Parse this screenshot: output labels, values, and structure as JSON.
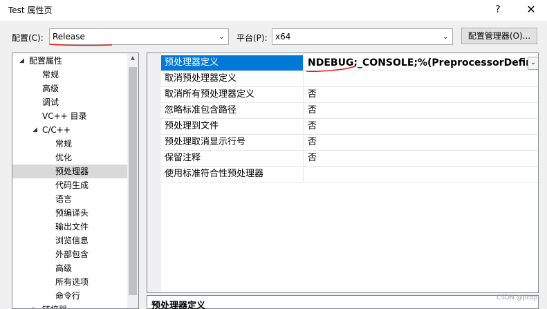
{
  "window": {
    "title": "Test 属性页",
    "help": "?",
    "close": "✕"
  },
  "config": {
    "label": "配置(C):",
    "value": "Release"
  },
  "platform": {
    "label": "平台(P):",
    "value": "x64"
  },
  "config_manager_button": "配置管理器(O)...",
  "icons": {
    "dropdown": "chevron-down-icon",
    "expand": "expand-arrow-icon",
    "scroll_up": "scroll-up-icon"
  },
  "tree": {
    "items": [
      {
        "label": "配置属性",
        "expander": "◢"
      },
      {
        "label": "常规"
      },
      {
        "label": "高级"
      },
      {
        "label": "调试"
      },
      {
        "label": "VC++ 目录"
      },
      {
        "label": "C/C++",
        "expander": "◢"
      },
      {
        "label": "常规"
      },
      {
        "label": "优化"
      },
      {
        "label": "预处理器"
      },
      {
        "label": "代码生成"
      },
      {
        "label": "语言"
      },
      {
        "label": "预编译头"
      },
      {
        "label": "输出文件"
      },
      {
        "label": "浏览信息"
      },
      {
        "label": "外部包含"
      },
      {
        "label": "高级"
      },
      {
        "label": "所有选项"
      },
      {
        "label": "命令行"
      },
      {
        "label": "链接器",
        "expander": "▷"
      }
    ]
  },
  "properties": [
    {
      "name": "预处理器定义",
      "value": "NDEBUG;_CONSOLE;%(PreprocessorDefini"
    },
    {
      "name": "取消预处理器定义",
      "value": ""
    },
    {
      "name": "取消所有预处理器定义",
      "value": "否"
    },
    {
      "name": "忽略标准包含路径",
      "value": "否"
    },
    {
      "name": "预处理到文件",
      "value": "否"
    },
    {
      "name": "预处理取消显示行号",
      "value": "否"
    },
    {
      "name": "保留注释",
      "value": "否"
    },
    {
      "name": "使用标准符合性预处理器",
      "value": ""
    }
  ],
  "description": {
    "title": "预处理器定义"
  },
  "watermark": "CSDN @pcop",
  "annotation_color": "#e8191c"
}
